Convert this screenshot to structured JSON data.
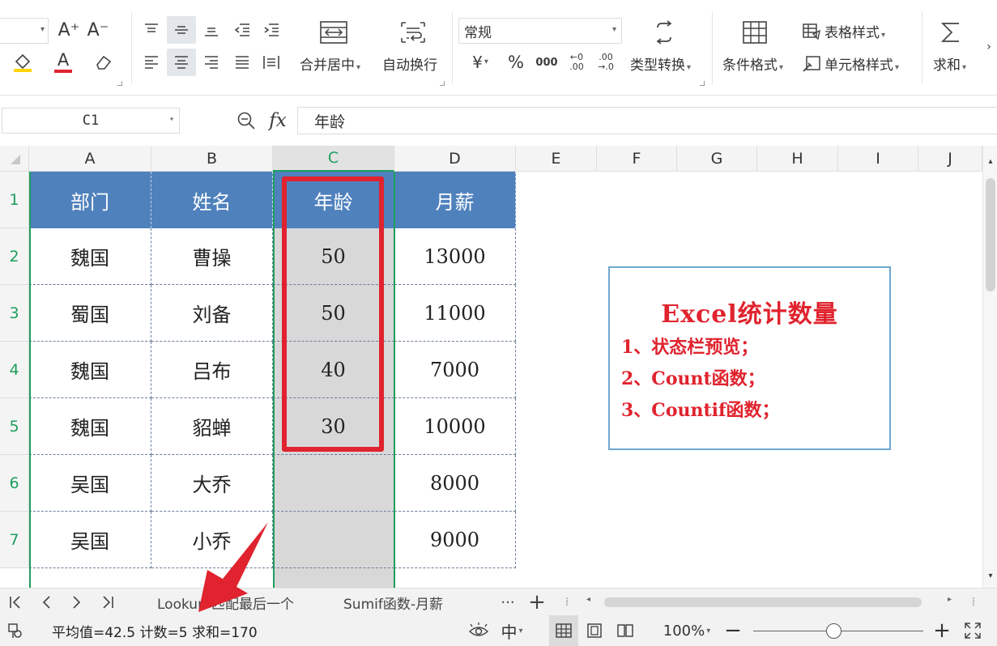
{
  "ribbon": {
    "merge_center_label": "合并居中",
    "wrap_text_label": "自动换行",
    "number_format_value": "常规",
    "currency_symbol": "¥",
    "percent_symbol": "%",
    "thousands_symbol": "000",
    "decimal_increase": "←0\n.00",
    "decimal_decrease": ".00\n→.0",
    "type_convert_label": "类型转换",
    "conditional_format_label": "条件格式",
    "table_style_label": "表格样式",
    "cell_style_label": "单元格样式",
    "sum_label": "求和",
    "font_grow": "A⁺",
    "font_shrink": "A⁻",
    "font_color_letter": "A"
  },
  "formula_bar": {
    "name_box": "C1",
    "fx_label": "fx",
    "formula": "年龄"
  },
  "grid": {
    "columns": [
      "A",
      "B",
      "C",
      "D",
      "E",
      "F",
      "G",
      "H",
      "I",
      "J"
    ],
    "rows": [
      "1",
      "2",
      "3",
      "4",
      "5",
      "6",
      "7"
    ],
    "active_column": "C",
    "header_fill_color": "#4f81bd",
    "selection_color": "#1e9e5e",
    "highlight_color": "#e0232e",
    "table": {
      "headers": [
        "部门",
        "姓名",
        "年龄",
        "月薪"
      ],
      "rows": [
        [
          "魏国",
          "曹操",
          "50",
          "13000"
        ],
        [
          "蜀国",
          "刘备",
          "50",
          "11000"
        ],
        [
          "魏国",
          "吕布",
          "40",
          "7000"
        ],
        [
          "魏国",
          "貂蝉",
          "30",
          "10000"
        ],
        [
          "吴国",
          "大乔",
          "",
          "8000"
        ],
        [
          "吴国",
          "小乔",
          "",
          "9000"
        ]
      ]
    },
    "note": {
      "title": "Excel统计数量",
      "lines": [
        "1、状态栏预览；",
        "2、Count函数；",
        "3、Countif函数；"
      ]
    }
  },
  "sheet_tabs": {
    "tabs": [
      "Lookup-匹配最后一个",
      "Sumif函数-月薪"
    ],
    "more": "···",
    "add": "+"
  },
  "status_bar": {
    "summary": "平均值=42.5  计数=5  求和=170",
    "input_mode": "中",
    "zoom_level": "100%"
  }
}
